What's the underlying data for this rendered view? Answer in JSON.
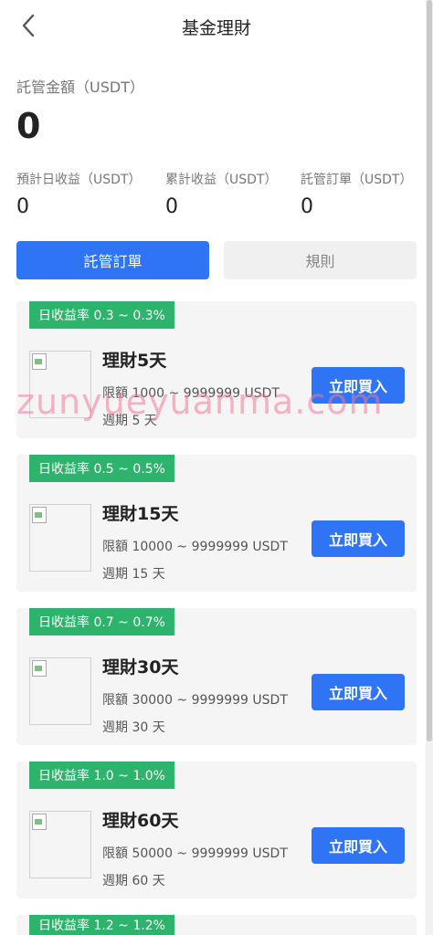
{
  "header": {
    "title": "基金理財"
  },
  "summary": {
    "total_label": "託管金額（USDT）",
    "total_value": "0",
    "stats": [
      {
        "label": "預計日收益（USDT）",
        "value": "0"
      },
      {
        "label": "累計收益（USDT）",
        "value": "0"
      },
      {
        "label": "託管訂單（USDT）",
        "value": "0"
      }
    ]
  },
  "tabs": [
    {
      "label": "託管訂單",
      "active": true
    },
    {
      "label": "規則",
      "active": false
    }
  ],
  "products": [
    {
      "rate": "日收益率  0.3 ~ 0.3%",
      "name": "理財5天",
      "limit": "限額 1000 ~ 9999999 USDT",
      "cycle": "週期 5 天",
      "button": "立即買入"
    },
    {
      "rate": "日收益率  0.5 ~ 0.5%",
      "name": "理財15天",
      "limit": "限額 10000 ~ 9999999 USDT",
      "cycle": "週期 15 天",
      "button": "立即買入"
    },
    {
      "rate": "日收益率  0.7 ~ 0.7%",
      "name": "理財30天",
      "limit": "限額 30000 ~ 9999999 USDT",
      "cycle": "週期 30 天",
      "button": "立即買入"
    },
    {
      "rate": "日收益率  1.0 ~ 1.0%",
      "name": "理財60天",
      "limit": "限額 50000 ~ 9999999 USDT",
      "cycle": "週期 60 天",
      "button": "立即買入"
    },
    {
      "rate": "日收益率  1.2 ~ 1.2%"
    }
  ],
  "watermark": "zunyueyuanma.com",
  "colors": {
    "accent": "#2f74f5",
    "rate_badge": "#2db36b",
    "card_bg": "#f5f5f5"
  }
}
